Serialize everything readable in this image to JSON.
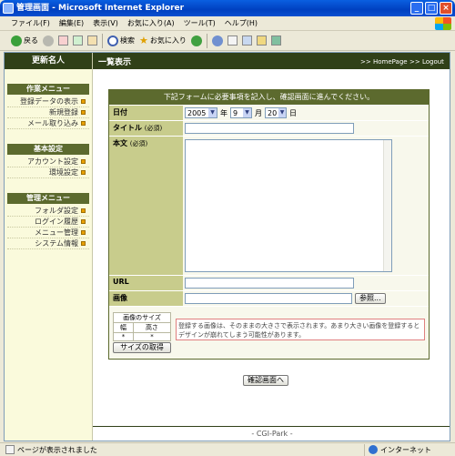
{
  "window": {
    "title": "管理画面 - Microsoft Internet Explorer"
  },
  "menubar": {
    "items": [
      "ファイル(F)",
      "編集(E)",
      "表示(V)",
      "お気に入り(A)",
      "ツール(T)",
      "ヘルプ(H)"
    ]
  },
  "toolbar": {
    "back": "戻る",
    "search": "検索",
    "favorites": "お気に入り"
  },
  "sidebar": {
    "header": "更新名人",
    "sections": [
      {
        "title": "作業メニュー",
        "items": [
          "登録データの表示",
          "新規登録",
          "メール取り込み"
        ]
      },
      {
        "title": "基本設定",
        "items": [
          "アカウント設定",
          "環境設定"
        ]
      },
      {
        "title": "管理メニュー",
        "items": [
          "フォルダ設定",
          "ログイン履歴",
          "メニュー管理",
          "システム情報"
        ]
      }
    ]
  },
  "main": {
    "title": "一覧表示",
    "links": {
      "homepage": ">> HomePage",
      "logout": ">> Logout"
    }
  },
  "form": {
    "instruction": "下記フォームに必要事項を記入し、確認画面に進んでください。",
    "date": {
      "label": "日付",
      "year": "2005",
      "year_unit": "年",
      "month": "9",
      "month_unit": "月",
      "day": "20",
      "day_unit": "日"
    },
    "title": {
      "label": "タイトル",
      "required": "(必須)",
      "value": ""
    },
    "body": {
      "label": "本文",
      "required": "(必須)",
      "value": ""
    },
    "url": {
      "label": "URL",
      "value": ""
    },
    "image": {
      "label": "画像",
      "value": "",
      "browse": "参照..."
    },
    "size": {
      "caption": "画像のサイズ",
      "width": "幅",
      "height": "高さ",
      "width_val": "*",
      "height_val": "*",
      "button": "サイズの取得"
    },
    "note": "登録する画像は、そのままの大きさで表示されます。あまり大きい画像を登録するとデザインが崩れてしまう可能性があります。",
    "submit": "確認画面へ"
  },
  "footer": "- CGI-Park -",
  "status": {
    "left": "ページが表示されました",
    "zone": "インターネット"
  }
}
